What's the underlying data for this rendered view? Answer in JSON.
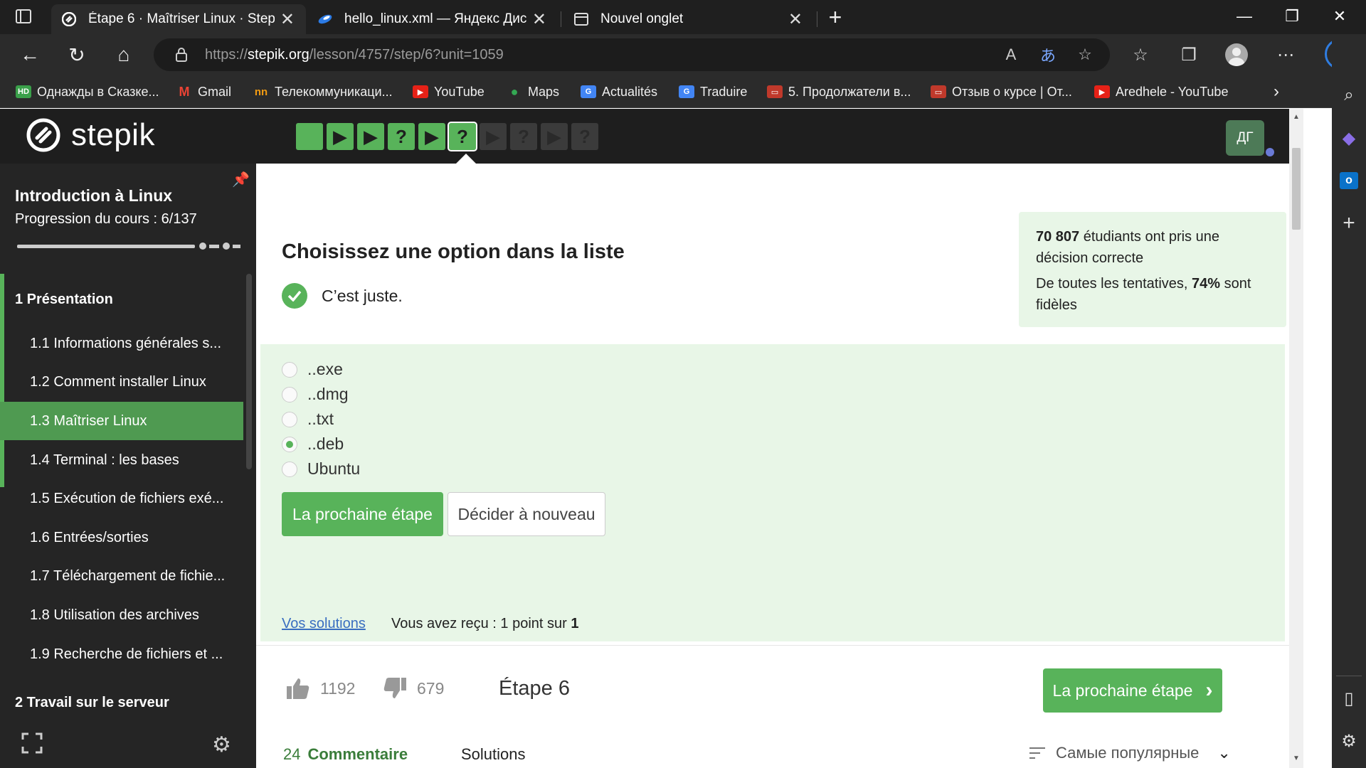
{
  "tabs": [
    {
      "title": "Étape 6 · Maîtriser Linux · Stepik",
      "active": true,
      "icon": "stepik-icon"
    },
    {
      "title": "hello_linux.xml — Яндекс Диск",
      "active": false,
      "icon": "yandex-disk-icon"
    },
    {
      "title": "Nouvel onglet",
      "active": false,
      "icon": "new-tab-icon"
    }
  ],
  "address": {
    "prefix": "https://",
    "domain": "stepik.org",
    "path": "/lesson/4757/step/6?unit=1059"
  },
  "bookmarks": [
    {
      "label": "Однажды в Сказке...",
      "color": "#3aa04a",
      "badge": "HD"
    },
    {
      "label": "Gmail",
      "color": "#ea4335",
      "badge": "M"
    },
    {
      "label": "Телекоммуникаци...",
      "color": "#f39c12",
      "badge": "nn"
    },
    {
      "label": "YouTube",
      "color": "#e62117",
      "badge": "▶"
    },
    {
      "label": "Maps",
      "color": "#34a853",
      "badge": "●"
    },
    {
      "label": "Actualités",
      "color": "#4285f4",
      "badge": "G"
    },
    {
      "label": "Traduire",
      "color": "#4285f4",
      "badge": "G"
    },
    {
      "label": "5. Продолжатели в...",
      "color": "#c0392b",
      "badge": "▭"
    },
    {
      "label": "Отзыв о курсе | От...",
      "color": "#c0392b",
      "badge": "▭"
    },
    {
      "label": "Aredhele - YouTube",
      "color": "#e62117",
      "badge": "▶"
    }
  ],
  "header": {
    "logo_text": "stepik",
    "avatar_initials": "ДГ",
    "steps": [
      "done",
      "play",
      "play",
      "quiz",
      "play",
      "quiz-current",
      "play-dim",
      "quiz-dim",
      "play-dim",
      "quiz-dim"
    ]
  },
  "sidebar": {
    "course_title": "Introduction à Linux",
    "progress": "Progression du cours : 6/137",
    "progress_fraction": 0.044,
    "sections": [
      {
        "label": "1 Présentation"
      },
      {
        "label": "2 Travail sur le serveur"
      }
    ],
    "lessons": [
      {
        "label": "1.1 Informations générales s..."
      },
      {
        "label": "1.2 Comment installer Linux"
      },
      {
        "label": "1.3 Maîtriser Linux",
        "active": true
      },
      {
        "label": "1.4 Terminal : les bases"
      },
      {
        "label": "1.5 Exécution de fichiers exé..."
      },
      {
        "label": "1.6 Entrées/sorties"
      },
      {
        "label": "1.7 Téléchargement de fichie..."
      },
      {
        "label": "1.8 Utilisation des archives"
      },
      {
        "label": "1.9 Recherche de fichiers et ..."
      }
    ]
  },
  "quiz": {
    "title": "Choisissez une option dans la liste",
    "correct_text": "C’est juste.",
    "stats_count": "70 807",
    "stats_line1": "étudiants ont pris une décision correcte",
    "stats_line2_prefix": "De toutes les tentatives,",
    "stats_percent": "74%",
    "stats_line2_suffix": "sont fidèles",
    "options": [
      {
        "label": "..exe",
        "selected": false
      },
      {
        "label": "..dmg",
        "selected": false
      },
      {
        "label": "..txt",
        "selected": false
      },
      {
        "label": "..deb",
        "selected": true
      },
      {
        "label": "Ubuntu",
        "selected": false
      }
    ],
    "next_button": "La prochaine étape",
    "retry_button": "Décider à nouveau",
    "solutions_link": "Vos solutions",
    "score_text": "Vous avez reçu : 1 point sur",
    "score_max": "1"
  },
  "footer": {
    "likes": "1192",
    "dislikes": "679",
    "step_label": "Étape 6",
    "next_button": "La prochaine étape",
    "comments_count": "24",
    "comments_label": "Commentaire",
    "solutions_label": "Solutions",
    "sort_label": "Самые популярные"
  },
  "colors": {
    "accent": "#58b35a",
    "sidebar_bg": "#252525",
    "answer_bg": "#e8f6e7"
  }
}
